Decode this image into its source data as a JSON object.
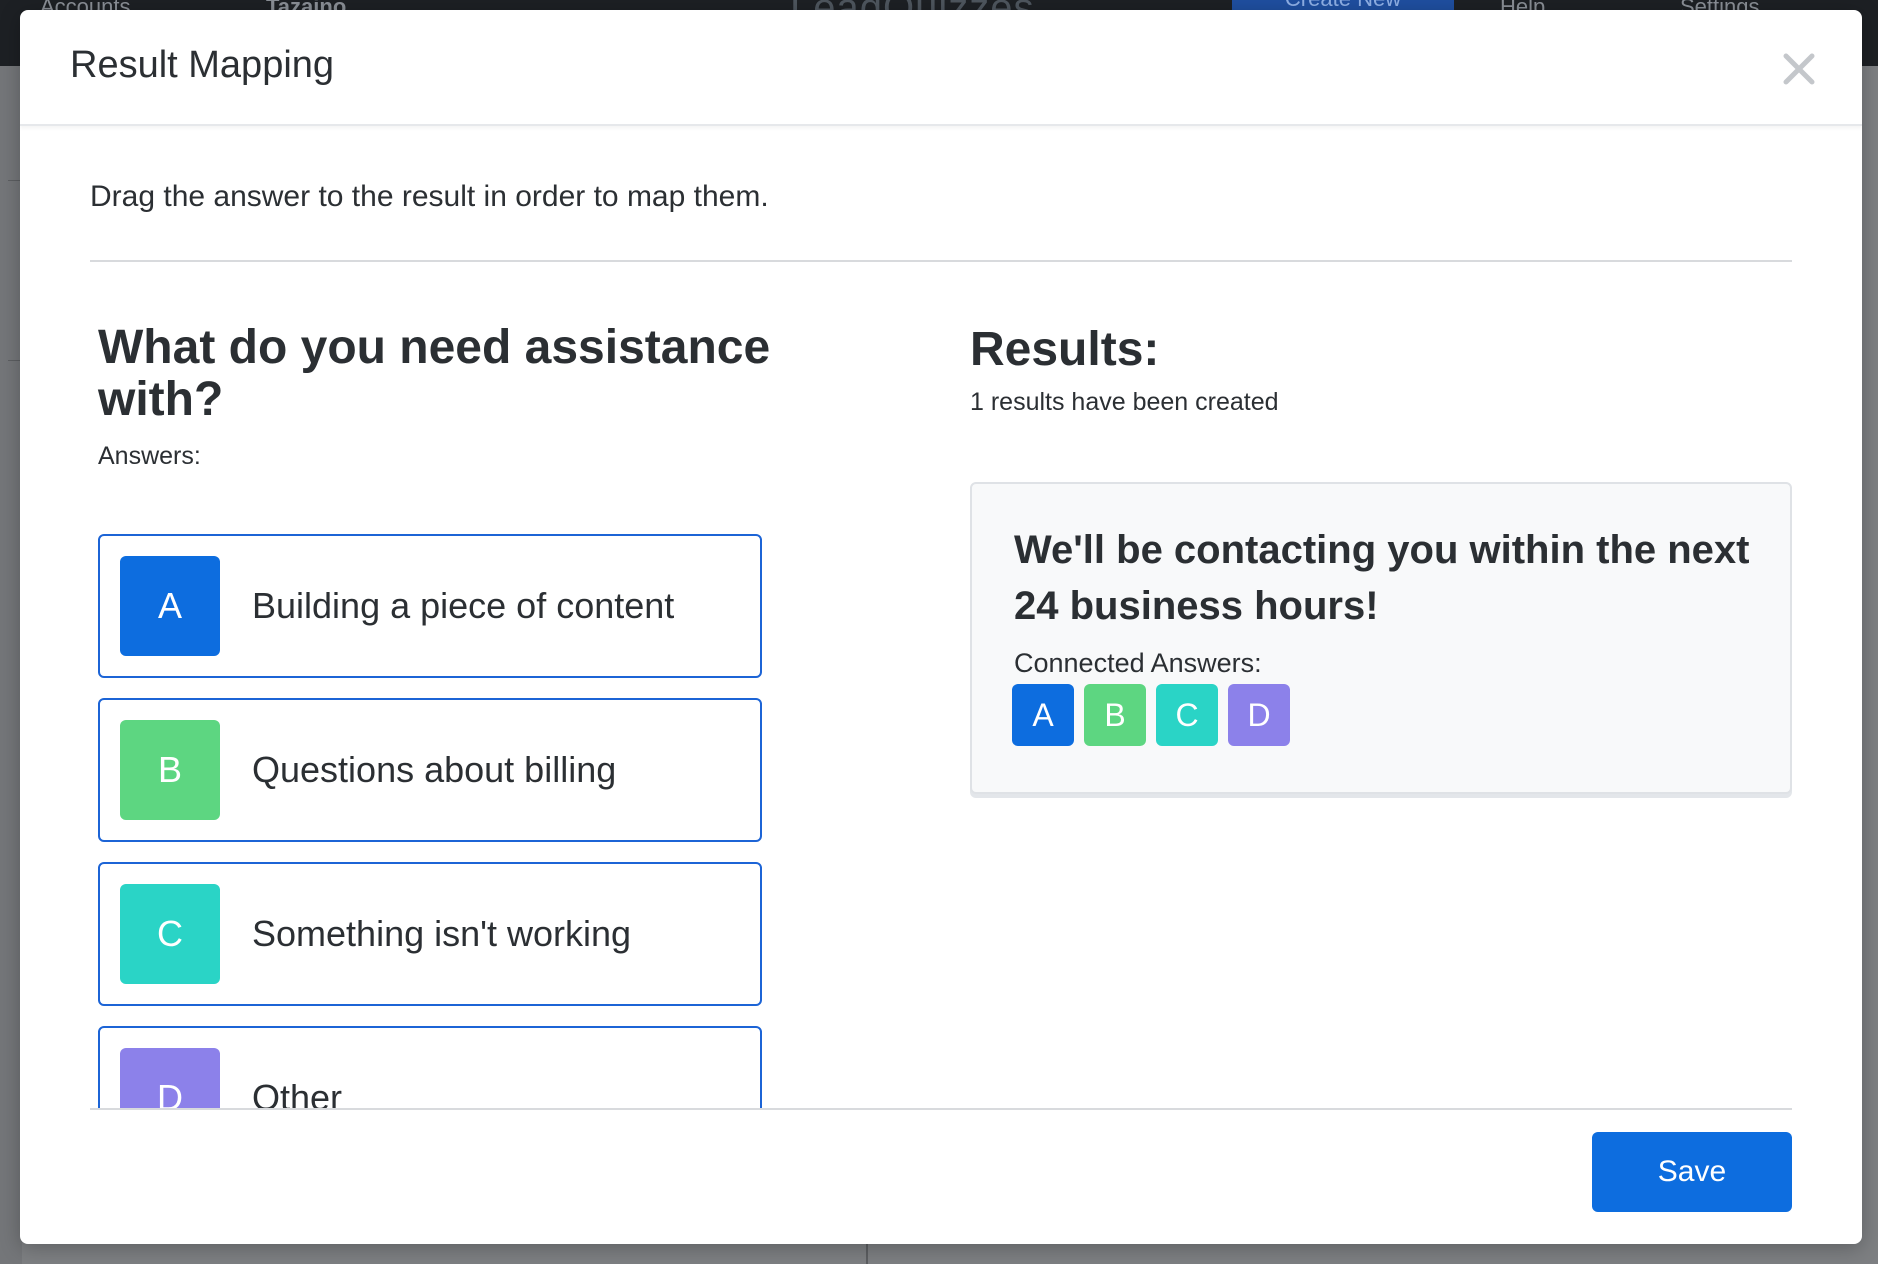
{
  "background": {
    "nav": {
      "accounts": "Accounts",
      "company": "Tazaino",
      "logo": "LeadQuizzes",
      "create_new": "Create New",
      "help": "Help",
      "settings": "Settings"
    }
  },
  "modal": {
    "title": "Result Mapping",
    "instruction": "Drag the answer to the result in order to map them.",
    "save_label": "Save"
  },
  "question": {
    "title": "What do you need assistance with?",
    "answers_label": "Answers:",
    "answers": [
      {
        "letter": "A",
        "text": "Building a piece of content",
        "color": "#0d6ddf"
      },
      {
        "letter": "B",
        "text": "Questions about billing",
        "color": "#5dd681"
      },
      {
        "letter": "C",
        "text": "Something isn't working",
        "color": "#2ad4c6"
      },
      {
        "letter": "D",
        "text": "Other",
        "color": "#8c81ea"
      }
    ]
  },
  "results": {
    "title": "Results:",
    "count_text": "1 results have been created",
    "items": [
      {
        "heading": "We'll be contacting you within the next 24 business hours!",
        "connected_label": "Connected Answers:",
        "connected": [
          "A",
          "B",
          "C",
          "D"
        ]
      }
    ]
  },
  "icons": {
    "close": "close-icon"
  }
}
